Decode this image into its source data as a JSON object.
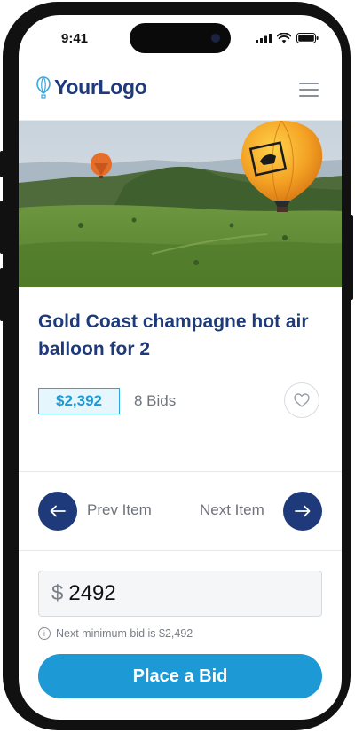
{
  "status_bar": {
    "time": "9:41"
  },
  "header": {
    "logo_text": "YourLogo"
  },
  "item": {
    "title": "Gold Coast champagne hot air balloon for 2",
    "price": "$2,392",
    "bids": "8 Bids"
  },
  "navigation": {
    "prev_label": "Prev Item",
    "next_label": "Next Item"
  },
  "bid": {
    "currency_symbol": "$",
    "amount": "2492",
    "hint": "Next minimum bid is $2,492",
    "button_label": "Place a Bid"
  },
  "colors": {
    "brand_navy": "#1f3a7a",
    "accent_blue": "#1d9ad6",
    "badge_bg": "#e6f6fd"
  },
  "icons": {
    "logo": "balloon-logo-icon",
    "menu": "hamburger-menu-icon",
    "favorite": "heart-icon",
    "prev": "arrow-left-icon",
    "next": "arrow-right-icon",
    "info": "info-icon"
  }
}
